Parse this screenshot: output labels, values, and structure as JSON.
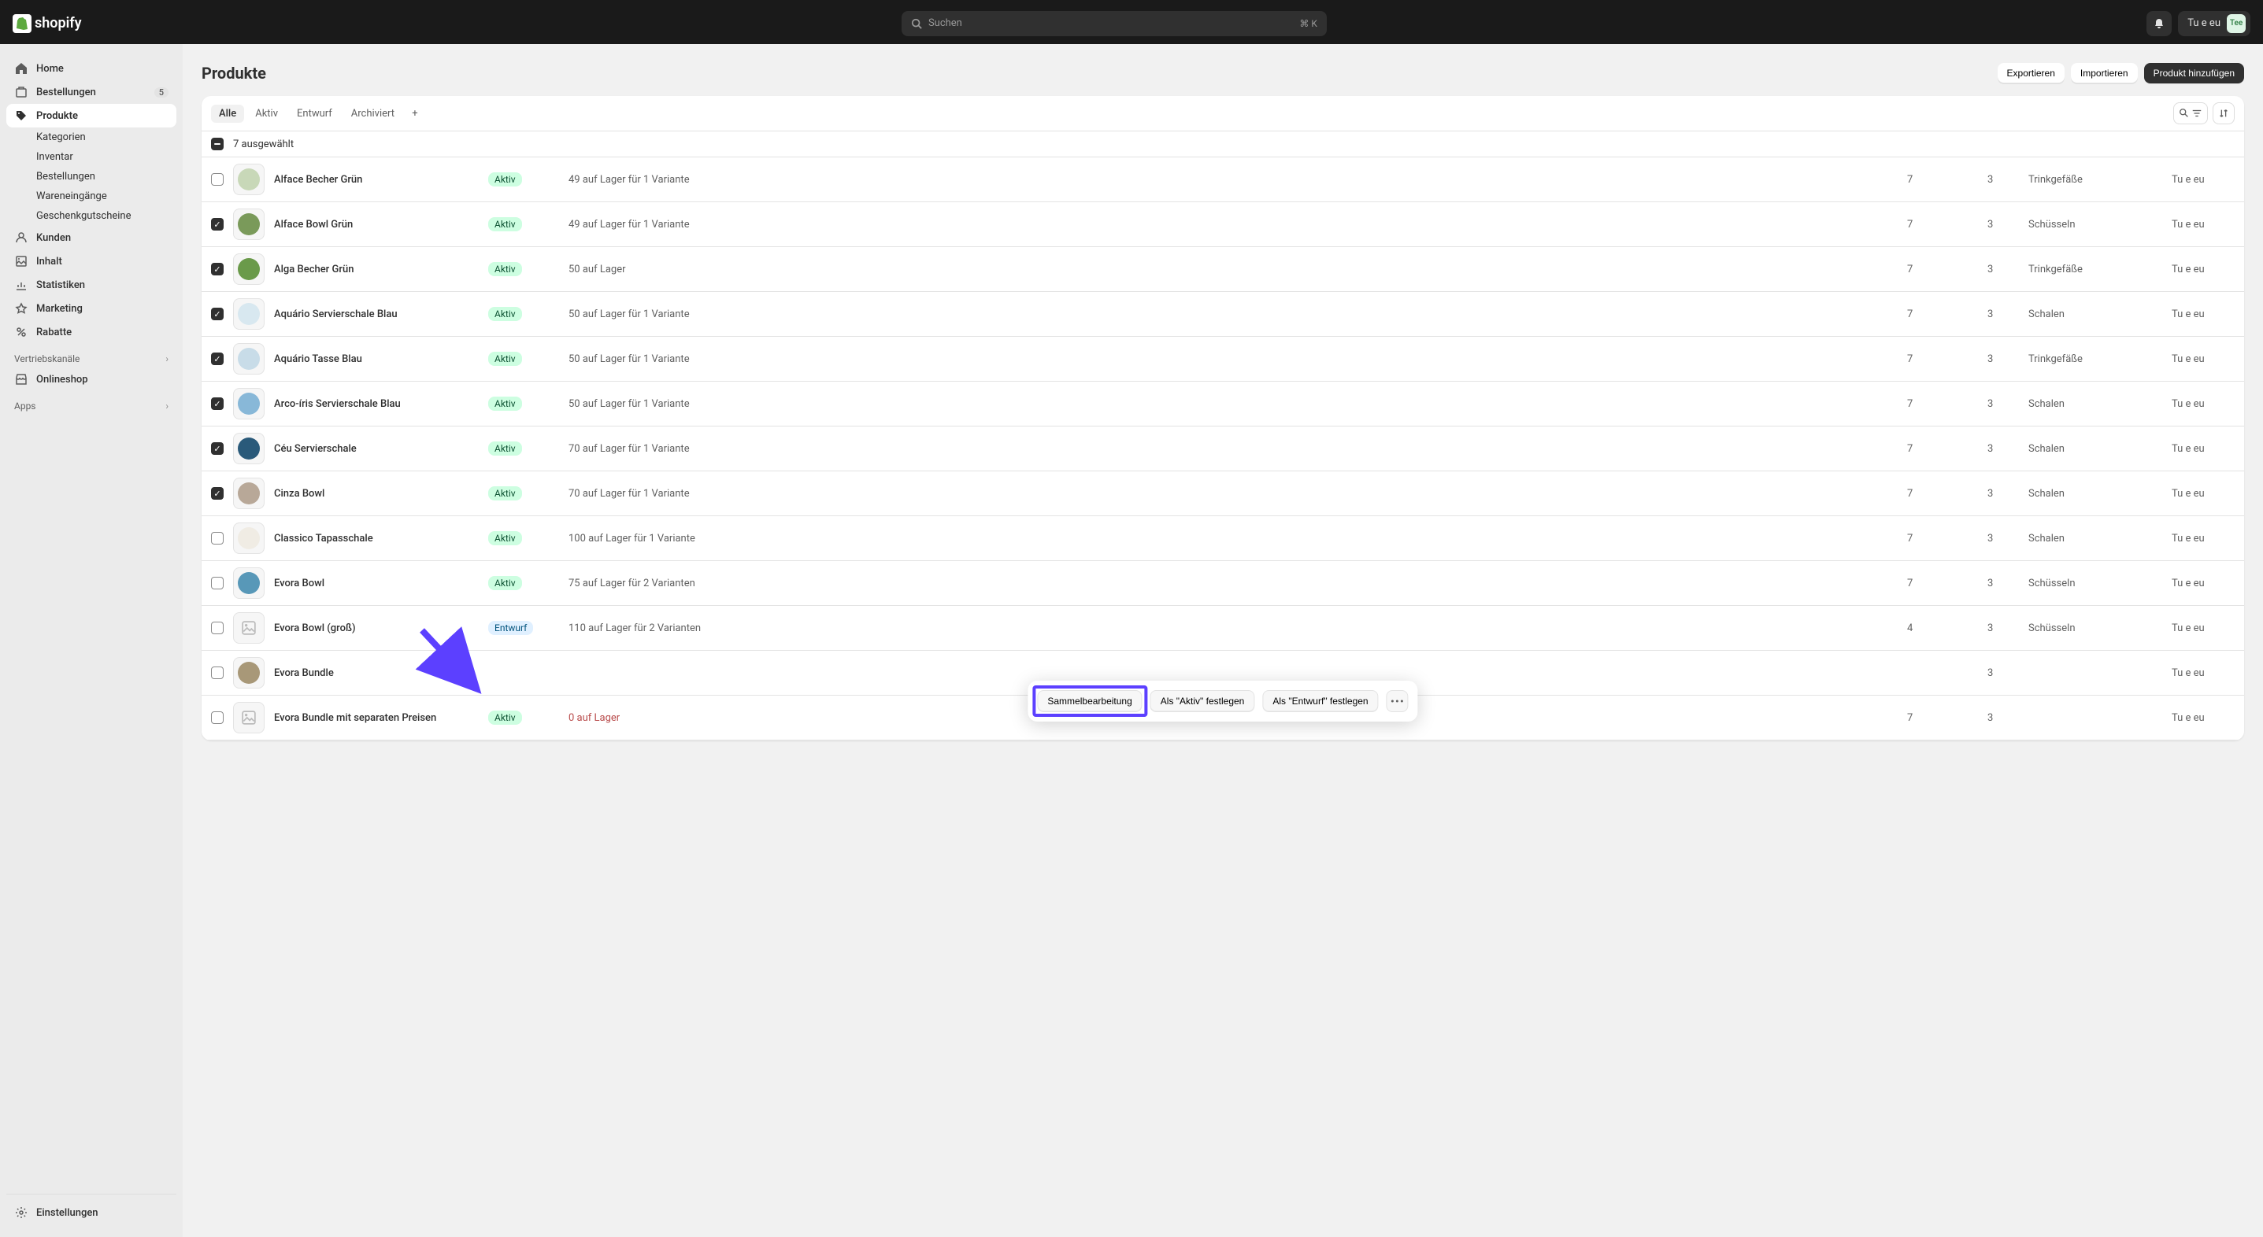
{
  "topbar": {
    "logo_text": "shopify",
    "search_placeholder": "Suchen",
    "search_shortcut": "⌘ K",
    "account_name": "Tu e eu",
    "avatar_initials": "Tee"
  },
  "sidebar": {
    "items": [
      {
        "label": "Home",
        "icon": "home"
      },
      {
        "label": "Bestellungen",
        "icon": "orders",
        "badge": "5"
      },
      {
        "label": "Produkte",
        "icon": "products",
        "active": true
      }
    ],
    "sub_items": [
      {
        "label": "Kategorien"
      },
      {
        "label": "Inventar"
      },
      {
        "label": "Bestellungen"
      },
      {
        "label": "Wareneingänge"
      },
      {
        "label": "Geschenkgutscheine"
      }
    ],
    "items2": [
      {
        "label": "Kunden",
        "icon": "customers"
      },
      {
        "label": "Inhalt",
        "icon": "content"
      },
      {
        "label": "Statistiken",
        "icon": "analytics"
      },
      {
        "label": "Marketing",
        "icon": "marketing"
      },
      {
        "label": "Rabatte",
        "icon": "discounts"
      }
    ],
    "section_sales": "Vertriebskanäle",
    "sales_items": [
      {
        "label": "Onlineshop",
        "icon": "store"
      }
    ],
    "section_apps": "Apps",
    "settings": {
      "label": "Einstellungen",
      "icon": "settings"
    }
  },
  "page": {
    "title": "Produkte",
    "export": "Exportieren",
    "import": "Importieren",
    "add": "Produkt hinzufügen"
  },
  "tabs": [
    {
      "label": "Alle",
      "active": true
    },
    {
      "label": "Aktiv"
    },
    {
      "label": "Entwurf"
    },
    {
      "label": "Archiviert"
    }
  ],
  "selected_text": "7 ausgewählt",
  "products": [
    {
      "checked": false,
      "name": "Alface Becher Grün",
      "status": "Aktiv",
      "stock": "49 auf Lager für 1 Variante",
      "n1": "7",
      "n2": "3",
      "cat": "Trinkgefäße",
      "vendor": "Tu e eu",
      "thumb": "#c8d8b8"
    },
    {
      "checked": true,
      "name": "Alface Bowl Grün",
      "status": "Aktiv",
      "stock": "49 auf Lager für 1 Variante",
      "n1": "7",
      "n2": "3",
      "cat": "Schüsseln",
      "vendor": "Tu e eu",
      "thumb": "#7a9a5a"
    },
    {
      "checked": true,
      "name": "Alga Becher Grün",
      "status": "Aktiv",
      "stock": "50 auf Lager",
      "n1": "7",
      "n2": "3",
      "cat": "Trinkgefäße",
      "vendor": "Tu e eu",
      "thumb": "#6a9a4a"
    },
    {
      "checked": true,
      "name": "Aquário Servierschale Blau",
      "status": "Aktiv",
      "stock": "50 auf Lager für 1 Variante",
      "n1": "7",
      "n2": "3",
      "cat": "Schalen",
      "vendor": "Tu e eu",
      "thumb": "#d8e8f0"
    },
    {
      "checked": true,
      "name": "Aquário Tasse Blau",
      "status": "Aktiv",
      "stock": "50 auf Lager für 1 Variante",
      "n1": "7",
      "n2": "3",
      "cat": "Trinkgefäße",
      "vendor": "Tu e eu",
      "thumb": "#c8dce8"
    },
    {
      "checked": true,
      "name": "Arco-íris Servierschale Blau",
      "status": "Aktiv",
      "stock": "50 auf Lager für 1 Variante",
      "n1": "7",
      "n2": "3",
      "cat": "Schalen",
      "vendor": "Tu e eu",
      "thumb": "#88b8d8"
    },
    {
      "checked": true,
      "name": "Céu Servierschale",
      "status": "Aktiv",
      "stock": "70 auf Lager für 1 Variante",
      "n1": "7",
      "n2": "3",
      "cat": "Schalen",
      "vendor": "Tu e eu",
      "thumb": "#2a5a7a"
    },
    {
      "checked": true,
      "name": "Cinza Bowl",
      "status": "Aktiv",
      "stock": "70 auf Lager für 1 Variante",
      "n1": "7",
      "n2": "3",
      "cat": "Schalen",
      "vendor": "Tu e eu",
      "thumb": "#b8a898"
    },
    {
      "checked": false,
      "name": "Classico Tapasschale",
      "status": "Aktiv",
      "stock": "100 auf Lager für 1 Variante",
      "n1": "7",
      "n2": "3",
      "cat": "Schalen",
      "vendor": "Tu e eu",
      "thumb": "#f0ece4"
    },
    {
      "checked": false,
      "name": "Evora Bowl",
      "status": "Aktiv",
      "stock": "75 auf Lager für 2 Varianten",
      "n1": "7",
      "n2": "3",
      "cat": "Schüsseln",
      "vendor": "Tu e eu",
      "thumb": "#5898b8"
    },
    {
      "checked": false,
      "name": "Evora Bowl (groß)",
      "status": "Entwurf",
      "stock": "110 auf Lager für 2 Varianten",
      "n1": "4",
      "n2": "3",
      "cat": "Schüsseln",
      "vendor": "Tu e eu",
      "thumb": "placeholder"
    },
    {
      "checked": false,
      "name": "Evora Bundle",
      "status": "",
      "stock": "",
      "n1": "",
      "n2": "3",
      "cat": "",
      "vendor": "Tu e eu",
      "thumb": "#a89878"
    },
    {
      "checked": false,
      "name": "Evora Bundle mit separaten Preisen",
      "status": "Aktiv",
      "stock": "0 auf Lager",
      "stock_red": true,
      "n1": "7",
      "n2": "3",
      "cat": "",
      "vendor": "Tu e eu",
      "thumb": "placeholder"
    }
  ],
  "bulk": {
    "edit": "Sammelbearbeitung",
    "set_active": "Als \"Aktiv\" festlegen",
    "set_draft": "Als \"Entwurf\" festlegen"
  }
}
